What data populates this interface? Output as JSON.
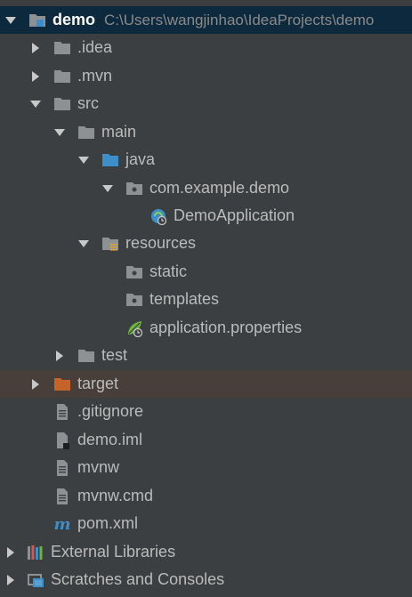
{
  "tree": {
    "root": {
      "name": "demo",
      "path": "C:\\Users\\wangjinhao\\IdeaProjects\\demo"
    },
    "items": [
      {
        "label": ".idea"
      },
      {
        "label": ".mvn"
      },
      {
        "label": "src"
      },
      {
        "label": "main"
      },
      {
        "label": "java"
      },
      {
        "label": "com.example.demo"
      },
      {
        "label": "DemoApplication"
      },
      {
        "label": "resources"
      },
      {
        "label": "static"
      },
      {
        "label": "templates"
      },
      {
        "label": "application.properties"
      },
      {
        "label": "test"
      },
      {
        "label": "target"
      },
      {
        "label": ".gitignore"
      },
      {
        "label": "demo.iml"
      },
      {
        "label": "mvnw"
      },
      {
        "label": "mvnw.cmd"
      },
      {
        "label": "pom.xml"
      }
    ],
    "external_libraries": "External Libraries",
    "scratches": "Scratches and Consoles"
  },
  "colors": {
    "background": "#3c3f41",
    "selected_row": "#0d293e",
    "excluded_row": "#493f3a",
    "folder": "#8d9194",
    "source_folder": "#3d8fc9",
    "excluded_folder": "#c4642a",
    "text": "#bbbbbb"
  }
}
